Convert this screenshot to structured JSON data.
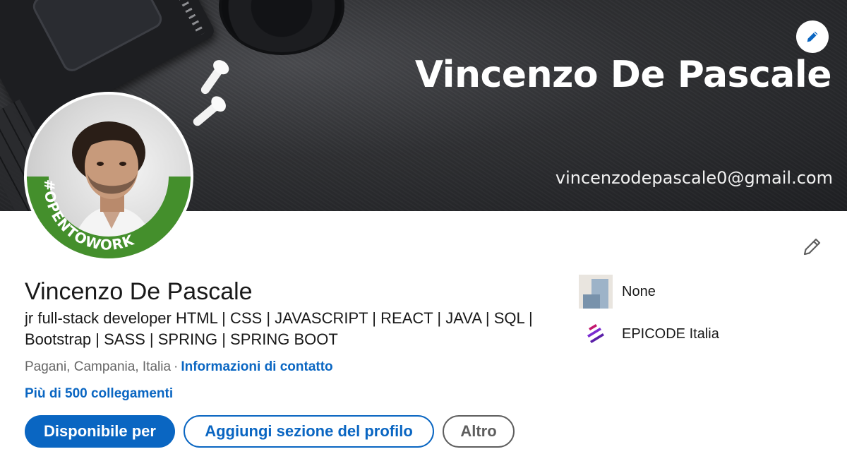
{
  "banner": {
    "title": "Vincenzo De Pascale",
    "email": "vincenzodepascale0@gmail.com",
    "edit_icon": "pencil-icon"
  },
  "avatar": {
    "badge_text": "#OPENTOWORK",
    "badge_color": "#448f2c"
  },
  "profile": {
    "name": "Vincenzo De Pascale",
    "headline": "jr full-stack developer HTML | CSS | JAVASCRIPT | REACT | JAVA | SQL | Bootstrap | SASS | SPRING | SPRING BOOT",
    "location": "Pagani, Campania, Italia",
    "separator": "·",
    "contact_link": "Informazioni di contatto",
    "connections": "Più di 500 collegamenti",
    "edit_icon": "pencil-outline-icon"
  },
  "actions": {
    "primary": "Disponibile per",
    "secondary": "Aggiungi sezione del profilo",
    "tertiary": "Altro"
  },
  "sidebar": {
    "items": [
      {
        "label": "None",
        "icon": "placeholder-company-logo"
      },
      {
        "label": "EPICODE Italia",
        "icon": "epicode-logo"
      }
    ]
  },
  "colors": {
    "link_blue": "#0a66c2",
    "text": "#191919",
    "muted": "#666666",
    "open_to_work_green": "#448f2c"
  }
}
